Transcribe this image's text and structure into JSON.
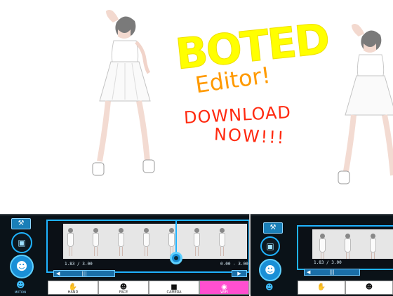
{
  "overlay": {
    "title": "BOTED",
    "subtitle": "Editor!",
    "cta_line1": "DOWNLOAD",
    "cta_line2": "NOW!!!"
  },
  "editor": {
    "time_left": "1.83 / 3.00",
    "time_right": "0.00 - 3.00",
    "scrub_label": "|||",
    "tabs": [
      "HAND",
      "FACE",
      "CAMERA",
      "WIFI"
    ],
    "colors": {
      "accent": "#1fb3ff",
      "tab_active": "#ff4fd0",
      "overlay_title": "#ffff00",
      "overlay_subtitle": "#ff9a00",
      "overlay_cta": "#ff2a10"
    },
    "icons": [
      "wrench-icon",
      "frame-icon",
      "person-icon",
      "hand-icon",
      "face-icon",
      "camera-icon",
      "wifi-icon",
      "play-icon"
    ]
  }
}
